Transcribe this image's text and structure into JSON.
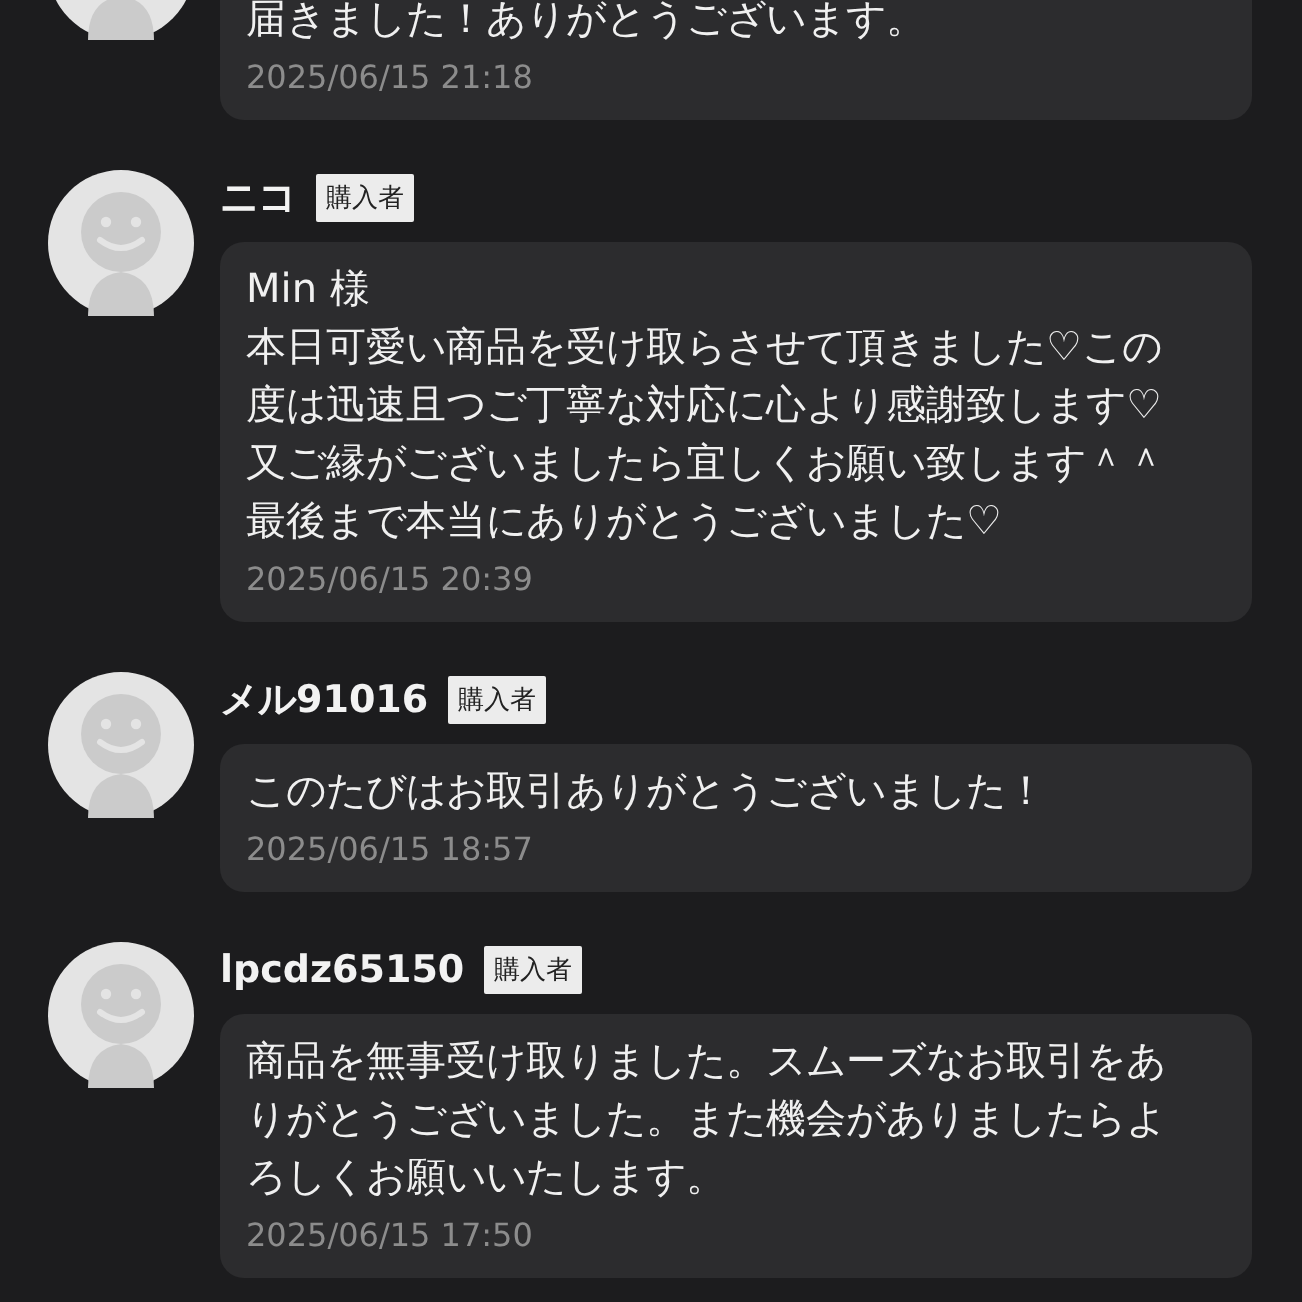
{
  "reviews": [
    {
      "lines": [
        "届きました！ありがとうございます。"
      ],
      "date": "2025/06/15 21:18"
    },
    {
      "name": "ニコ",
      "badge": "購入者",
      "lines": [
        "Min 様",
        "本日可愛い商品を受け取らさせて頂きました♡この",
        "度は迅速且つご丁寧な対応に心より感謝致します♡",
        "又ご縁がございましたら宜しくお願い致します＾＾",
        "最後まで本当にありがとうございました♡"
      ],
      "date": "2025/06/15 20:39"
    },
    {
      "name": "メル91016",
      "badge": "購入者",
      "lines": [
        "このたびはお取引ありがとうございました！"
      ],
      "date": "2025/06/15 18:57"
    },
    {
      "name": "lpcdz65150",
      "badge": "購入者",
      "lines": [
        "商品を無事受け取りました。スムーズなお取引をあ",
        "りがとうございました。また機会がありましたらよ",
        "ろしくお願いいたします。"
      ],
      "date": "2025/06/15 17:50"
    }
  ]
}
